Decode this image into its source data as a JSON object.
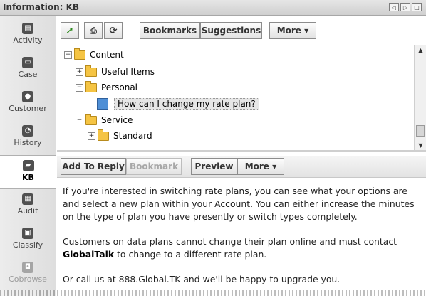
{
  "window": {
    "title": "Information: KB"
  },
  "sidebar": {
    "items": [
      {
        "label": "Activity",
        "icon": "clipboard-icon"
      },
      {
        "label": "Case",
        "icon": "case-icon"
      },
      {
        "label": "Customer",
        "icon": "person-icon"
      },
      {
        "label": "History",
        "icon": "history-icon"
      },
      {
        "label": "KB",
        "icon": "kb-icon"
      },
      {
        "label": "Audit",
        "icon": "audit-icon"
      },
      {
        "label": "Classify",
        "icon": "classify-icon"
      },
      {
        "label": "Cobrowse",
        "icon": "chat-icon"
      }
    ],
    "active": "KB",
    "disabled": [
      "Cobrowse"
    ]
  },
  "toolbar": {
    "bookmarks": "Bookmarks",
    "suggestions": "Suggestions",
    "more": "More"
  },
  "tree": {
    "content": "Content",
    "useful_items": "Useful Items",
    "personal": "Personal",
    "article": "How can I change my rate plan?",
    "service": "Service",
    "standard": "Standard"
  },
  "article_toolbar": {
    "add_to_reply": "Add To Reply",
    "bookmark": "Bookmark",
    "preview": "Preview",
    "more": "More"
  },
  "article": {
    "p1": "If you're interested in switching rate plans, you can see what your options are and select a new plan within your Account. You can either increase the minutes on the type of plan you have presently or switch types completely.",
    "p2_pre": "Customers on data plans cannot change their plan online and must contact ",
    "p2_bold": "GlobalTalk",
    "p2_post": " to change to a different rate plan.",
    "p3": "Or call us at 888.Global.TK and we'll be happy to upgrade you."
  }
}
